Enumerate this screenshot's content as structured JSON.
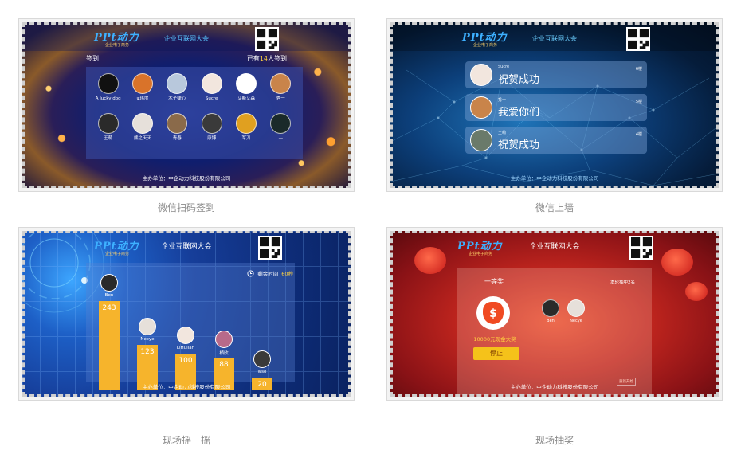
{
  "panels": [
    {
      "caption": "微信扫码签到",
      "title": "企业互联网大会",
      "logo_main": "PPt动力",
      "logo_sub": "企业电子商务",
      "signin_label": "签到",
      "count_prefix": "已有",
      "count_num": "14",
      "count_suffix": "人签到",
      "users": [
        "A lucky dog",
        "ψ玮尔",
        "木子婕心",
        "Sucre",
        "艾斯艾森",
        "秀一",
        "王萌",
        "熊之天天",
        "青春",
        "康博",
        "军刀",
        "—"
      ],
      "footer": "主办单位：中企动力科技股份有限公司"
    },
    {
      "caption": "微信上墙",
      "title": "企业互联网大会",
      "logo_main": "PPt动力",
      "logo_sub": "企业电子商务",
      "messages": [
        {
          "user": "Sucre",
          "text": "祝贺成功",
          "floor": "6楼"
        },
        {
          "user": "秀一",
          "text": "我爱你们",
          "floor": "5楼"
        },
        {
          "user": "王萌",
          "text": "祝贺成功",
          "floor": "4楼"
        }
      ],
      "footer": "生办单位：中企动力科技股份有限公司"
    },
    {
      "caption": "现场摇一摇",
      "title": "企业互联网大会",
      "logo_main": "PPt动力",
      "logo_sub": "企业电子商务",
      "timer_label": "剩余时间",
      "timer_value": "60秒",
      "footer": "主办单位：中企动力科技股份有限公司"
    },
    {
      "caption": "现场抽奖",
      "title": "企业互联网大会",
      "logo_main": "PPt动力",
      "logo_sub": "企业电子商务",
      "prize_title": "一等奖",
      "round_info": "本轮抽中2名",
      "prize_name": "10000元现金大奖",
      "stop_label": "停止",
      "reset_label": "重新开始",
      "winners": [
        "Ben",
        "Necye"
      ],
      "footer": "主办单位：中企动力科技股份有限公司"
    }
  ],
  "chart_data": {
    "type": "bar",
    "categories": [
      "Ben",
      "Necye",
      "LiHuilan",
      "栖欣",
      "wso"
    ],
    "values": [
      243,
      123,
      100,
      88,
      20
    ]
  },
  "colors": {
    "accent_yellow": "#f6b42c",
    "highlight": "#ffd23f"
  }
}
